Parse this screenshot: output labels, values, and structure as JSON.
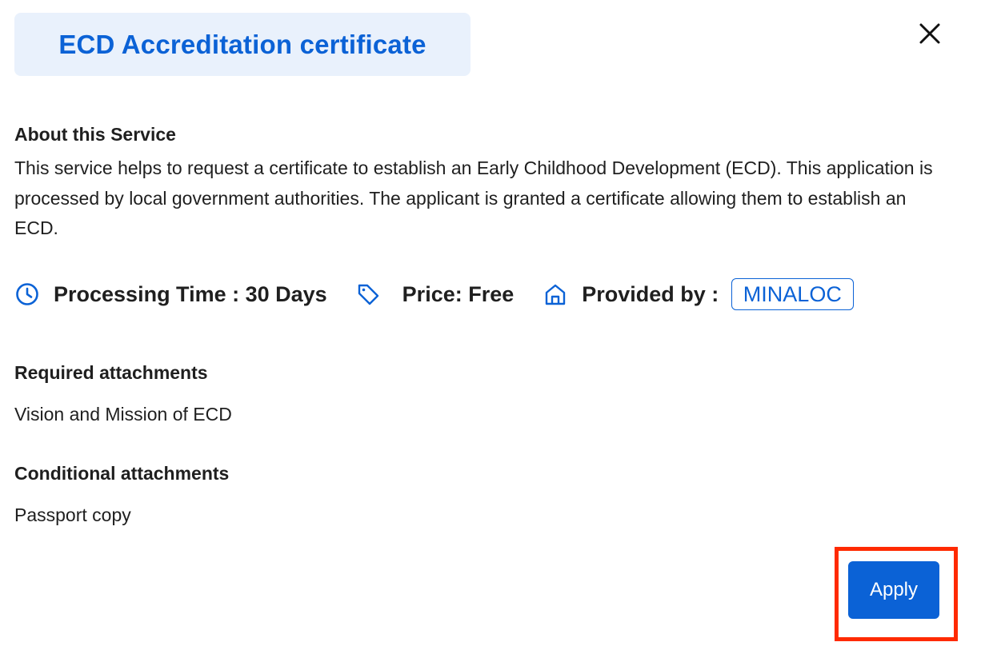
{
  "modal": {
    "title": "ECD Accreditation certificate",
    "close_icon": "close-icon"
  },
  "about": {
    "heading": "About this Service",
    "text": "This service helps to request a certificate to establish an Early Childhood Development (ECD). This application is processed by local government authorities. The applicant is granted a certificate allowing them to establish an ECD."
  },
  "meta": {
    "processing_time": "Processing Time : 30 Days",
    "price": "Price: Free",
    "provided_by_label": "Provided by : ",
    "provider": "MINALOC",
    "icons": [
      "clock-icon",
      "price-tag-icon",
      "home-icon"
    ]
  },
  "attachments": {
    "required_heading": "Required attachments",
    "required_items": [
      "Vision and Mission of ECD"
    ],
    "conditional_heading": "Conditional attachments",
    "conditional_items": [
      "Passport copy"
    ]
  },
  "actions": {
    "apply_label": "Apply"
  },
  "colors": {
    "accent": "#0b62d6",
    "title_chip_bg": "#e9f1fc",
    "highlight": "#ff2a00",
    "text": "#1f1f1f"
  }
}
